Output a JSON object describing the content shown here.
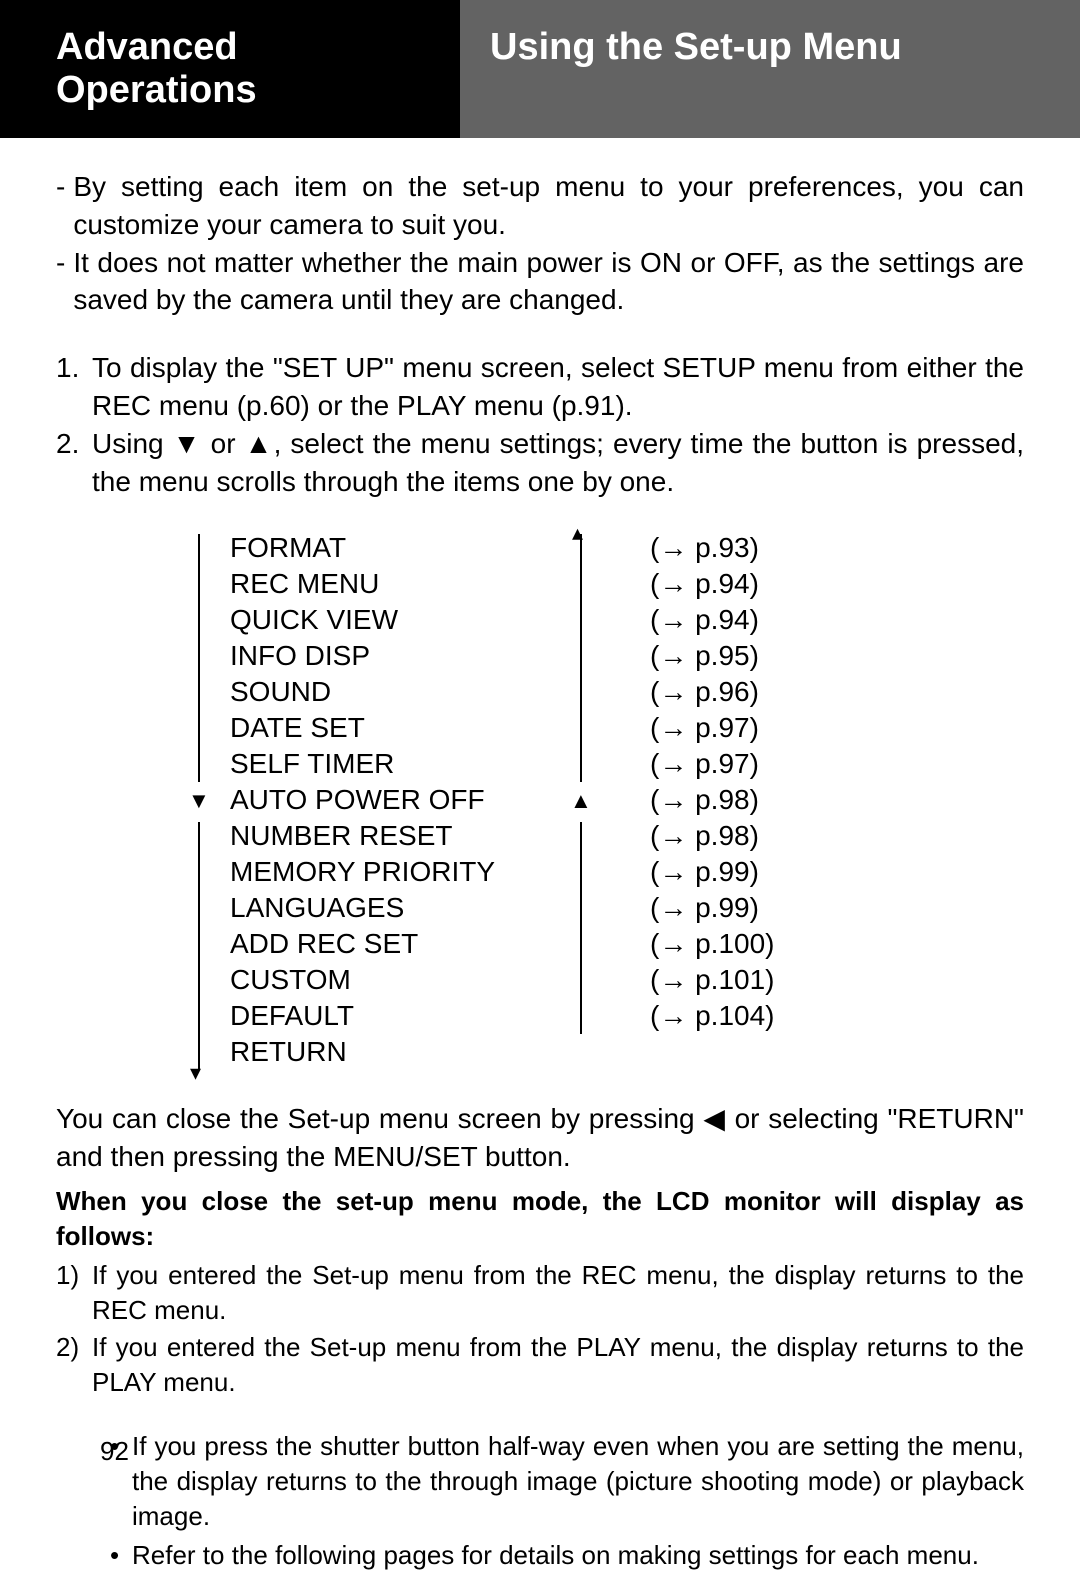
{
  "header": {
    "left": "Advanced Operations",
    "right": "Using the Set-up Menu"
  },
  "intro": [
    "By setting each item on the set-up menu to your preferences, you can customize your camera to suit you.",
    "It does not matter whether the main power is ON or OFF, as the settings are saved by the camera until they are changed."
  ],
  "steps": [
    "To display the \"SET UP\" menu screen, select SETUP menu from either the REC menu (p.60) or the PLAY menu (p.91).",
    "Using ▼ or ▲, select the menu settings; every time the button is pressed, the menu scrolls through the items one by one."
  ],
  "menu": [
    {
      "label": "FORMAT",
      "ref": "(→ p.93)"
    },
    {
      "label": "REC MENU",
      "ref": "(→ p.94)"
    },
    {
      "label": "QUICK VIEW",
      "ref": "(→ p.94)"
    },
    {
      "label": "INFO DISP",
      "ref": "(→ p.95)"
    },
    {
      "label": "SOUND",
      "ref": "(→ p.96)"
    },
    {
      "label": "DATE SET",
      "ref": "(→ p.97)"
    },
    {
      "label": "SELF TIMER",
      "ref": "(→ p.97)"
    },
    {
      "label": "AUTO POWER OFF",
      "ref": "(→ p.98)"
    },
    {
      "label": "NUMBER RESET",
      "ref": "(→ p.98)"
    },
    {
      "label": "MEMORY PRIORITY",
      "ref": "(→ p.99)"
    },
    {
      "label": "LANGUAGES",
      "ref": "(→ p.99)"
    },
    {
      "label": "ADD REC SET",
      "ref": "(→ p.100)"
    },
    {
      "label": "CUSTOM",
      "ref": "(→ p.101)"
    },
    {
      "label": "DEFAULT",
      "ref": "(→ p.104)"
    },
    {
      "label": "RETURN",
      "ref": ""
    }
  ],
  "close_text": "You can close the Set-up menu screen by pressing ◀ or selecting \"RETURN\" and then pressing the MENU/SET button.",
  "bold_note": "When you close the set-up menu mode, the LCD monitor will display as follows:",
  "sublist": [
    "If you entered the Set-up menu from the REC menu, the display returns to the REC menu.",
    "If you entered the Set-up menu from the PLAY menu, the display returns to the PLAY menu."
  ],
  "bullets": [
    "If you press the shutter button half-way even when you are setting the menu, the display returns to the through image (picture shooting mode) or playback image.",
    "Refer to the following pages for details on making settings for each menu."
  ],
  "page_number": "92"
}
